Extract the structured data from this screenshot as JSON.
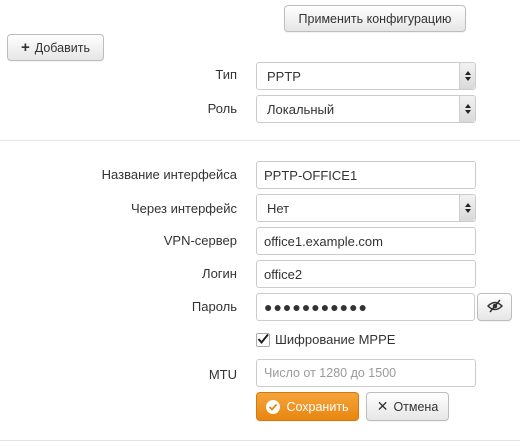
{
  "toolbar": {
    "apply_label": "Применить конфигурацию",
    "add_label": "Добавить"
  },
  "form": {
    "type": {
      "label": "Тип",
      "value": "PPTP"
    },
    "role": {
      "label": "Роль",
      "value": "Локальный"
    },
    "name": {
      "label": "Название интерфейса",
      "value": "PPTP-OFFICE1"
    },
    "via": {
      "label": "Через интерфейс",
      "value": "Нет"
    },
    "server": {
      "label": "VPN-сервер",
      "value": "office1.example.com"
    },
    "login": {
      "label": "Логин",
      "value": "office2"
    },
    "password": {
      "label": "Пароль",
      "value": "●●●●●●●●●●●"
    },
    "mppe": {
      "label": "Шифрование MPPE",
      "checked": true
    },
    "mtu": {
      "label": "MTU",
      "placeholder": "Число от 1280 до 1500"
    }
  },
  "actions": {
    "save_label": "Сохранить",
    "cancel_label": "Отмена"
  },
  "colors": {
    "save_accent": "#f0901f",
    "border": "#cccccc",
    "divider": "#e5e5e5"
  }
}
